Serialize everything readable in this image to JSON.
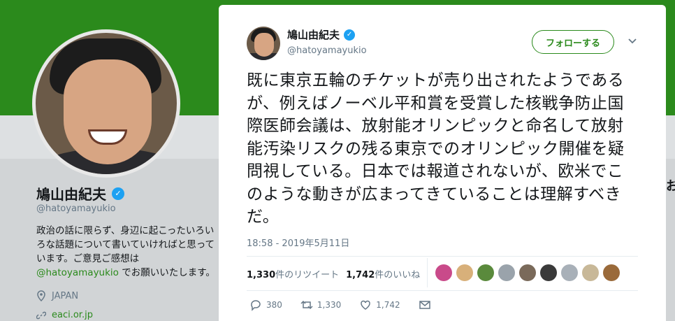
{
  "profile": {
    "name": "鳩山由紀夫",
    "handle": "@hatoyamayukio",
    "bio_prefix": "政治の話に限らず、身辺に起こったいろいろな話題について書いていければと思っています。ご意見ご感想は",
    "bio_mention": "@hatoyamayukio",
    "bio_suffix": " でお願いいたします。",
    "location": "JAPAN",
    "url": "eaci.or.jp",
    "right_peek": "お"
  },
  "tweet": {
    "author_name": "鳩山由紀夫",
    "author_handle": "@hatoyamayukio",
    "follow_label": "フォローする",
    "text": "既に東京五輪のチケットが売り出されたようであるが、例えばノーベル平和賞を受賞した核戦争防止国際医師会議は、放射能オリンピックと命名して放射能汚染リスクの残る東京でのオリンピック開催を疑問視している。日本では報道されないが、欧米でこのような動きが広まってきていることは理解すべきだ。",
    "timestamp": "18:58 - 2019年5月11日",
    "retweets_count": "1,330",
    "retweets_label": "件のリツイート",
    "likes_count": "1,742",
    "likes_label": "件のいいね",
    "reply_count": "380",
    "retweet_action_count": "1,330",
    "like_action_count": "1,742"
  },
  "colors": {
    "theme_green": "#2b8a1c",
    "verified_blue": "#1da1f2",
    "liker_avatars": [
      "#c94a8a",
      "#d8b07a",
      "#5a8a3c",
      "#9aa3ab",
      "#7a6a5a",
      "#3a3a3a",
      "#a8b0b8",
      "#c8b898",
      "#9a6a3a"
    ]
  }
}
